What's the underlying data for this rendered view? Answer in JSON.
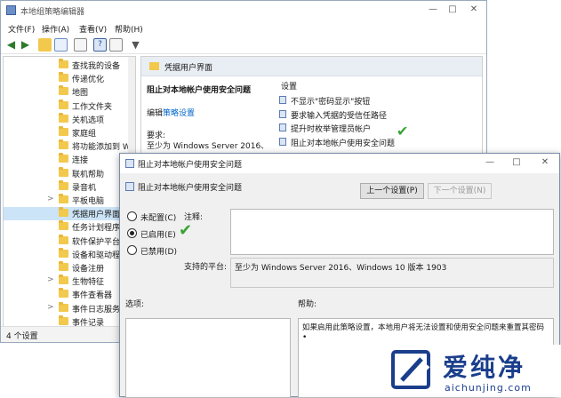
{
  "main": {
    "title": "本地组策略编辑器",
    "menu": [
      "文件(F)",
      "操作(A)",
      "查看(V)",
      "帮助(H)"
    ],
    "tree_items": [
      {
        "label": "查找我的设备",
        "expander": ""
      },
      {
        "label": "传递优化",
        "expander": ""
      },
      {
        "label": "地图",
        "expander": ""
      },
      {
        "label": "工作文件夹",
        "expander": ""
      },
      {
        "label": "关机选项",
        "expander": ""
      },
      {
        "label": "家庭组",
        "expander": ""
      },
      {
        "label": "将功能添加到 Wi",
        "expander": ""
      },
      {
        "label": "连接",
        "expander": ""
      },
      {
        "label": "联机帮助",
        "expander": ""
      },
      {
        "label": "录音机",
        "expander": ""
      },
      {
        "label": "平板电脑",
        "expander": ">"
      },
      {
        "label": "凭据用户界面",
        "expander": "",
        "selected": true
      },
      {
        "label": "任务计划程序",
        "expander": ""
      },
      {
        "label": "软件保护平台",
        "expander": ""
      },
      {
        "label": "设备和驱动程序",
        "expander": ""
      },
      {
        "label": "设备注册",
        "expander": ""
      },
      {
        "label": "生物特征",
        "expander": ">"
      },
      {
        "label": "事件查看器",
        "expander": ""
      },
      {
        "label": "事件日志服务",
        "expander": ">"
      },
      {
        "label": "事件记录",
        "expander": ""
      }
    ],
    "status": "4 个设置",
    "right_header": "凭据用户界面",
    "policy_title": "阻止对本地帐户使用安全问题",
    "edit_prefix": "编辑",
    "edit_link": "策略设置",
    "requirements_label": "要求:",
    "requirements_text": "至少为 Windows Server 2016、",
    "settings_header": "设置",
    "settings": [
      "不显示\"密码显示\"按钮",
      "要求输入凭据的受信任路径",
      "提升时枚举管理员帐户",
      "阻止对本地帐户使用安全问题"
    ]
  },
  "dialog": {
    "title": "阻止对本地帐户使用安全问题",
    "subtitle": "阻止对本地帐户使用安全问题",
    "prev_button": "上一个设置(P)",
    "next_button": "下一个设置(N)",
    "radios": [
      "未配置(C)",
      "已启用(E)",
      "已禁用(D)"
    ],
    "selected_radio": "已启用(E)",
    "comment_label": "注释:",
    "platform_label": "支持的平台:",
    "platform_value": "至少为 Windows Server 2016、Windows 10 版本 1903",
    "options_label": "选项:",
    "help_label": "帮助:",
    "help_text": "如果启用此策略设置，本地用户将无法设置和使用安全问题来重置其密码",
    "help_bullet": "•"
  },
  "watermark": {
    "brand": "爱纯净",
    "url": "aichunjing.com"
  },
  "colors": {
    "accent": "#0066cc",
    "selection": "#cce4f7",
    "check": "#3aa335",
    "watermark": "#1a3e8c"
  }
}
